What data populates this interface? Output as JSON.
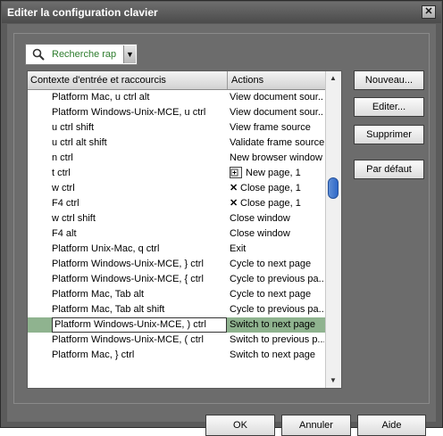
{
  "window": {
    "title": "Editer la configuration clavier",
    "close_glyph": "✕"
  },
  "search": {
    "placeholder": "Recherche rap"
  },
  "list": {
    "columns": [
      "Contexte d'entrée et raccourcis",
      "Actions"
    ],
    "rows": [
      {
        "key": "Platform Mac, u ctrl alt",
        "action": "View document sour..."
      },
      {
        "key": "Platform Windows-Unix-MCE, u ctrl",
        "action": "View document sour..."
      },
      {
        "key": "u ctrl shift",
        "action": "View frame source"
      },
      {
        "key": "u ctrl alt shift",
        "action": "Validate frame source"
      },
      {
        "key": "n ctrl",
        "action": "New browser window"
      },
      {
        "key": "t ctrl",
        "action": "New page, 1",
        "icon": "new-page-icon"
      },
      {
        "key": "w ctrl",
        "action": "Close page, 1",
        "icon": "close-x-icon"
      },
      {
        "key": "F4 ctrl",
        "action": "Close page, 1",
        "icon": "close-x-icon"
      },
      {
        "key": "w ctrl shift",
        "action": "Close window"
      },
      {
        "key": "F4 alt",
        "action": "Close window"
      },
      {
        "key": "Platform Unix-Mac, q ctrl",
        "action": "Exit"
      },
      {
        "key": "Platform Windows-Unix-MCE, } ctrl",
        "action": "Cycle to next page"
      },
      {
        "key": "Platform Windows-Unix-MCE, { ctrl",
        "action": "Cycle to previous pa..."
      },
      {
        "key": "Platform Mac, Tab alt",
        "action": "Cycle to next page"
      },
      {
        "key": "Platform Mac, Tab alt shift",
        "action": "Cycle to previous pa..."
      },
      {
        "key": "Platform Windows-Unix-MCE, ) ctrl",
        "action": "Switch to next page",
        "selected": true
      },
      {
        "key": "Platform Windows-Unix-MCE, ( ctrl",
        "action": "Switch to previous p..."
      },
      {
        "key": "Platform Mac, } ctrl",
        "action": "Switch to next page"
      }
    ]
  },
  "side_buttons": {
    "new": "Nouveau...",
    "edit": "Editer...",
    "delete": "Supprimer",
    "default": "Par défaut"
  },
  "bottom_buttons": {
    "ok": "OK",
    "cancel": "Annuler",
    "help": "Aide"
  },
  "colors": {
    "titlebar": "#5a5a5a",
    "client": "#6c6c6c",
    "selected_row": "#8fb38f",
    "search_text": "#2e7d2e",
    "scroll_thumb": "#3a72cc"
  }
}
